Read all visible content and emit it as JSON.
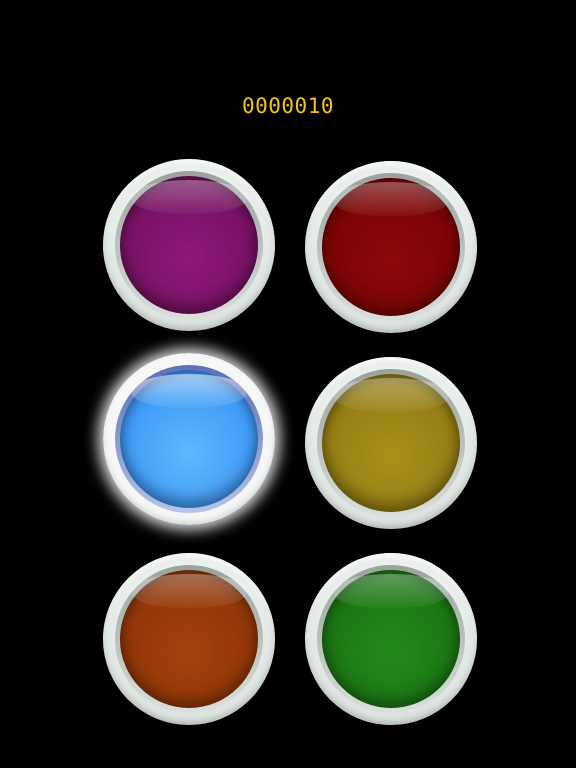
{
  "score": {
    "value": "0000010",
    "color": "#f2c318"
  },
  "buttons": [
    {
      "color_name": "purple",
      "color": "#741060",
      "lit": false
    },
    {
      "color_name": "red",
      "color": "#780404",
      "lit": false
    },
    {
      "color_name": "blue",
      "color": "#3a96f5",
      "lit": true
    },
    {
      "color_name": "yellow",
      "color": "#917a12",
      "lit": false
    },
    {
      "color_name": "orange",
      "color": "#8e3508",
      "lit": false
    },
    {
      "color_name": "green",
      "color": "#1a7313",
      "lit": false
    }
  ]
}
